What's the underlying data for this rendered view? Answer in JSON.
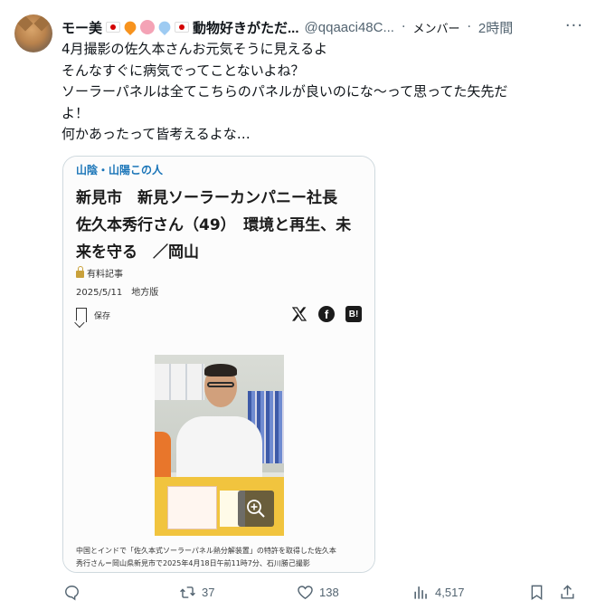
{
  "tweet": {
    "display_name": "モー美",
    "name_suffix": "動物好きがただ...",
    "handle": "@qqaaci48C...",
    "separator": "·",
    "member_label": "メンバー",
    "time": "2時間",
    "more_label": "···",
    "emoji_icons": [
      "japan-flag-icon",
      "orange-heart-icon",
      "pig-face-icon",
      "blue-heart-icon",
      "japan-flag-icon"
    ],
    "text_lines": [
      "4月撮影の佐久本さんお元気そうに見えるよ",
      "そんなすぐに病気でってことないよね？",
      "ソーラーパネルは全てこちらのパネルが良いのにな〜って思ってた矢先だ",
      "よ！",
      "何かあったって皆考えるよな…"
    ]
  },
  "card": {
    "kicker": "山陰・山陽この人",
    "headline_lines": [
      "新見市　新見ソーラーカンパニー社長",
      "佐久本秀行さん（49）　環境と再生、未",
      "来を守る　／岡山"
    ],
    "paid_label": "有料記事",
    "date_line": "2025/5/11　地方版",
    "save_label": "保存",
    "share_icons": [
      "x-logo-icon",
      "facebook-icon",
      "hatena-bookmark-icon"
    ],
    "hatena_label": "B!",
    "facebook_label": "f",
    "caption_lines": [
      "中国とインドで「佐久本式ソーラーパネル熱分解装置」の特許を取得した佐久本",
      "秀行さん＝岡山県新見市で2025年4月18日午前11時7分、石川勝己撮影"
    ]
  },
  "actions": {
    "replies": "",
    "retweets": "37",
    "likes": "138",
    "views": "4,517"
  },
  "colors": {
    "text_primary": "#0f1419",
    "text_secondary": "#536471",
    "kicker_blue": "#1a75b8",
    "border": "#cfd9de"
  }
}
